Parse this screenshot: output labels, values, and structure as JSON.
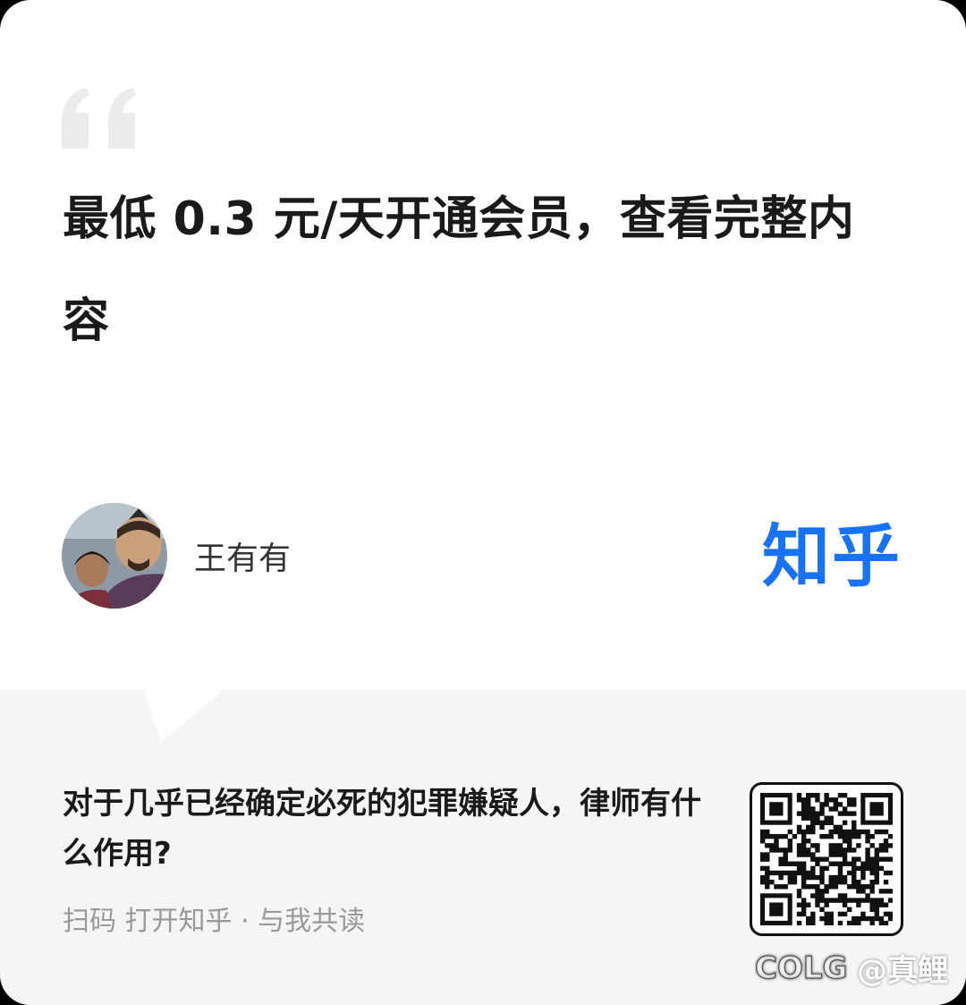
{
  "card": {
    "headline": "最低 0.3 元/天开通会员，查看完整内容",
    "author": {
      "name": "王有有",
      "avatar_icon": "avatar-cartoon-characters"
    },
    "brand": {
      "logo_text": "知乎",
      "color": "#1772f6"
    }
  },
  "footer": {
    "question": "对于几乎已经确定必死的犯罪嫌疑人，律师有什么作用?",
    "scan_caption": "扫码 打开知乎 · 与我共读",
    "qr_icon": "qr-code"
  },
  "watermark": {
    "logo_text": "COLG",
    "handle": "@真鲤"
  }
}
